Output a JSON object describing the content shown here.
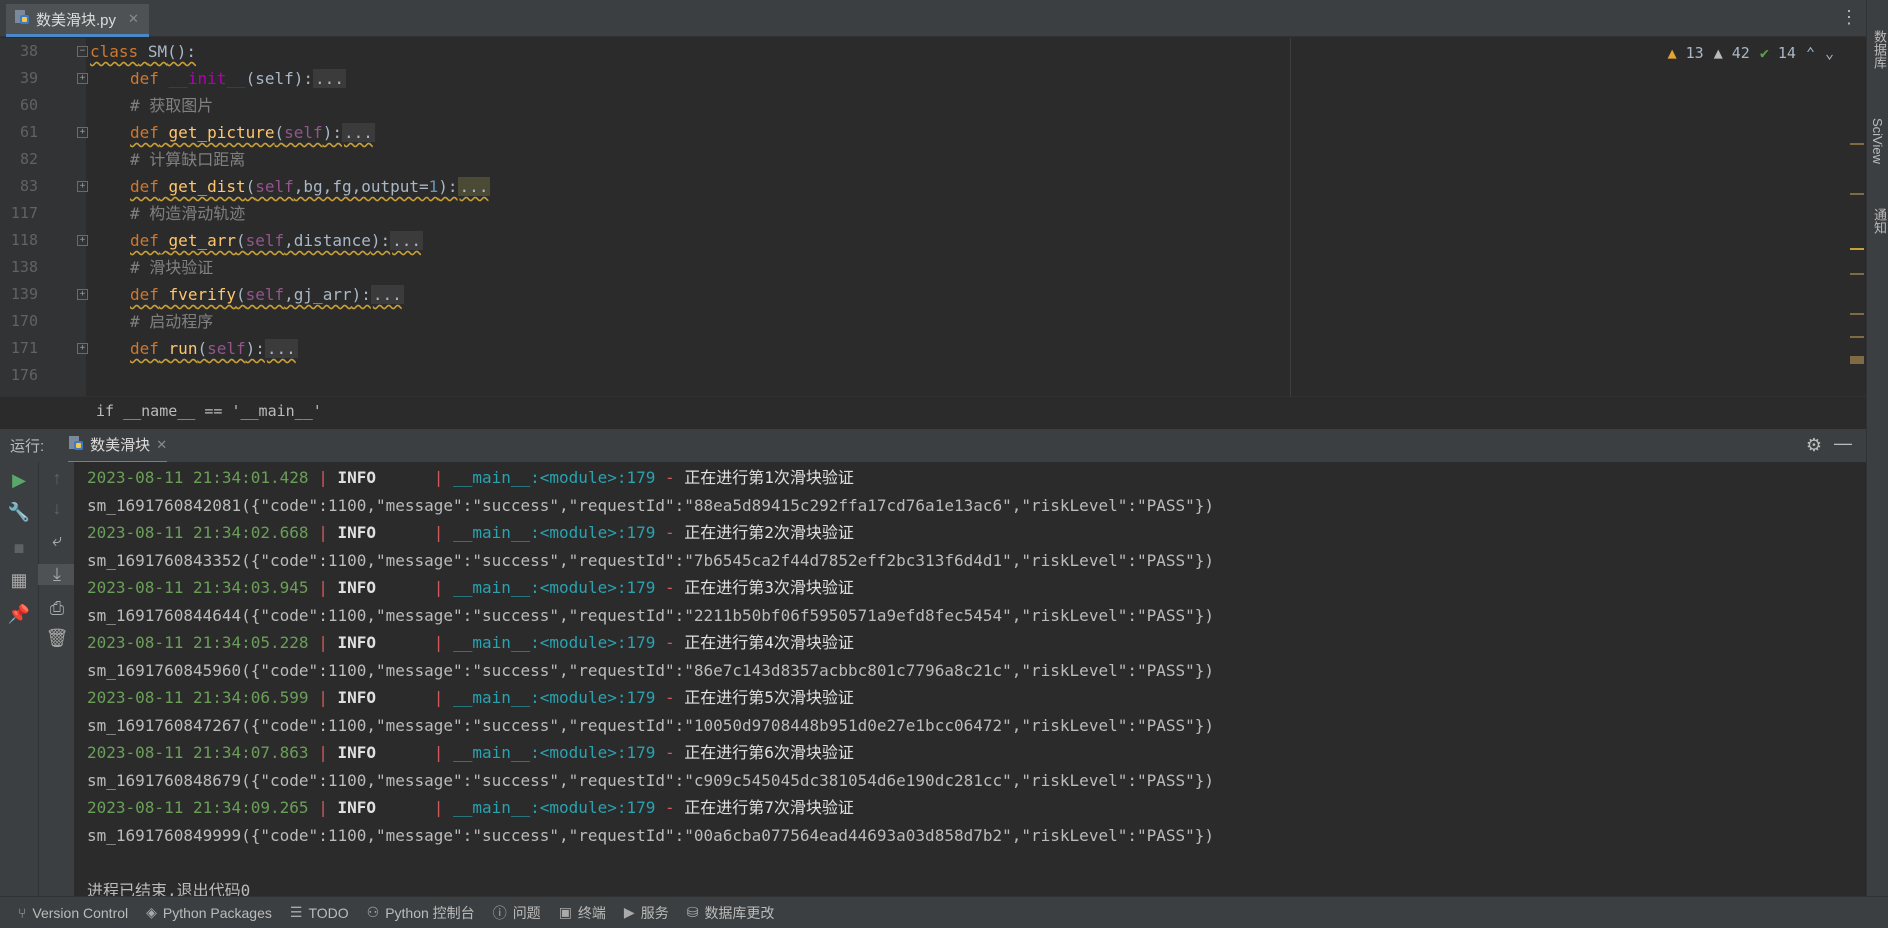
{
  "tab": {
    "filename": "数美滑块.py"
  },
  "inspections": {
    "warn_count": "13",
    "weak_count": "42",
    "ok_count": "14"
  },
  "editor": {
    "line_numbers": [
      "38",
      "39",
      "60",
      "61",
      "82",
      "83",
      "117",
      "118",
      "138",
      "139",
      "170",
      "171",
      "176"
    ],
    "breadcrumb": "if __name__ == '__main__'"
  },
  "code": {
    "class_kw": "class",
    "class_name": "SM",
    "class_paren": "():",
    "def_kw": "def",
    "init_name": "__init__",
    "init_args": "(self):",
    "init_fold": "...",
    "cmt1": "# 获取图片",
    "pic_name": "get_picture",
    "pic_open": "(",
    "pic_self": "self",
    "pic_close": "):",
    "pic_fold": "...",
    "cmt2": "# 计算缺口距离",
    "dist_name": "get_dist",
    "dist_open": "(",
    "dist_self": "self",
    "dist_mid": ",bg,fg,output=",
    "dist_num": "1",
    "dist_close": "):",
    "dist_fold": "...",
    "cmt3": "# 构造滑动轨迹",
    "arr_name": "get_arr",
    "arr_open": "(",
    "arr_self": "self",
    "arr_mid": ",distance",
    "arr_close": "):",
    "arr_fold": "...",
    "cmt4": "# 滑块验证",
    "fv_name": "fverify",
    "fv_open": "(",
    "fv_self": "self",
    "fv_mid": ",gj_arr",
    "fv_close": "):",
    "fv_fold": "...",
    "cmt5": "# 启动程序",
    "run_name": "run",
    "run_open": "(",
    "run_self": "self",
    "run_close": "):",
    "run_fold": "..."
  },
  "run_panel": {
    "label": "运行:",
    "tab_name": "数美滑块"
  },
  "console": {
    "sep": " | ",
    "level": "INFO     ",
    "sep2": " | ",
    "module": "__main__:<module>:179",
    "dash": " - ",
    "entries": [
      {
        "ts": "2023-08-11 21:34:01.428",
        "msg": "正在进行第1次滑块验证",
        "out": "sm_1691760842081({\"code\":1100,\"message\":\"success\",\"requestId\":\"88ea5d89415c292ffa17cd76a1e13ac6\",\"riskLevel\":\"PASS\"})"
      },
      {
        "ts": "2023-08-11 21:34:02.668",
        "msg": "正在进行第2次滑块验证",
        "out": "sm_1691760843352({\"code\":1100,\"message\":\"success\",\"requestId\":\"7b6545ca2f44d7852eff2bc313f6d4d1\",\"riskLevel\":\"PASS\"})"
      },
      {
        "ts": "2023-08-11 21:34:03.945",
        "msg": "正在进行第3次滑块验证",
        "out": "sm_1691760844644({\"code\":1100,\"message\":\"success\",\"requestId\":\"2211b50bf06f5950571a9efd8fec5454\",\"riskLevel\":\"PASS\"})"
      },
      {
        "ts": "2023-08-11 21:34:05.228",
        "msg": "正在进行第4次滑块验证",
        "out": "sm_1691760845960({\"code\":1100,\"message\":\"success\",\"requestId\":\"86e7c143d8357acbbc801c7796a8c21c\",\"riskLevel\":\"PASS\"})"
      },
      {
        "ts": "2023-08-11 21:34:06.599",
        "msg": "正在进行第5次滑块验证",
        "out": "sm_1691760847267({\"code\":1100,\"message\":\"success\",\"requestId\":\"10050d9708448b951d0e27e1bcc06472\",\"riskLevel\":\"PASS\"})"
      },
      {
        "ts": "2023-08-11 21:34:07.863",
        "msg": "正在进行第6次滑块验证",
        "out": "sm_1691760848679({\"code\":1100,\"message\":\"success\",\"requestId\":\"c909c545045dc381054d6e190dc281cc\",\"riskLevel\":\"PASS\"})"
      },
      {
        "ts": "2023-08-11 21:34:09.265",
        "msg": "正在进行第7次滑块验证",
        "out": "sm_1691760849999({\"code\":1100,\"message\":\"success\",\"requestId\":\"00a6cba077564ead44693a03d858d7b2\",\"riskLevel\":\"PASS\"})"
      }
    ],
    "exit": "进程已结束,退出代码0"
  },
  "right_rail": [
    "数据库",
    "SciView",
    "通知"
  ],
  "status_bar": [
    {
      "icon": "vcs-icon",
      "label": "Version Control"
    },
    {
      "icon": "packages-icon",
      "label": "Python Packages"
    },
    {
      "icon": "todo-icon",
      "label": "TODO"
    },
    {
      "icon": "python-console-icon",
      "label": "Python 控制台"
    },
    {
      "icon": "problems-icon",
      "label": "问题"
    },
    {
      "icon": "terminal-icon",
      "label": "终端"
    },
    {
      "icon": "services-icon",
      "label": "服务"
    },
    {
      "icon": "db-changes-icon",
      "label": "数据库更改"
    }
  ]
}
